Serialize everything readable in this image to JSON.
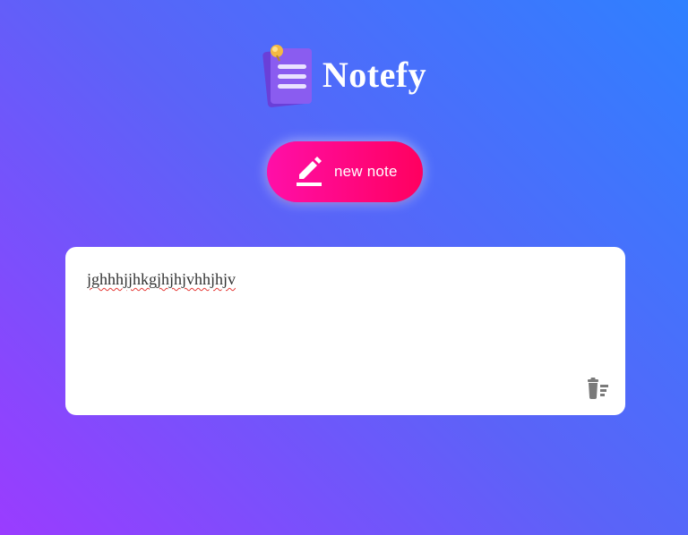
{
  "app": {
    "title": "Notefy",
    "logo_icon": "notepad-pin-icon"
  },
  "toolbar": {
    "new_note_label": "new note",
    "new_note_icon": "pencil-icon"
  },
  "notes": [
    {
      "text": "jghhhjjhkgjhjhjvhhjhjv",
      "delete_icon": "trash-icon"
    }
  ],
  "colors": {
    "background_start": "#9a3cff",
    "background_end": "#2f80ff",
    "button_start": "#ff0fa8",
    "button_end": "#ff005f",
    "card": "#ffffff",
    "icon_gray": "#7a7a7a"
  }
}
